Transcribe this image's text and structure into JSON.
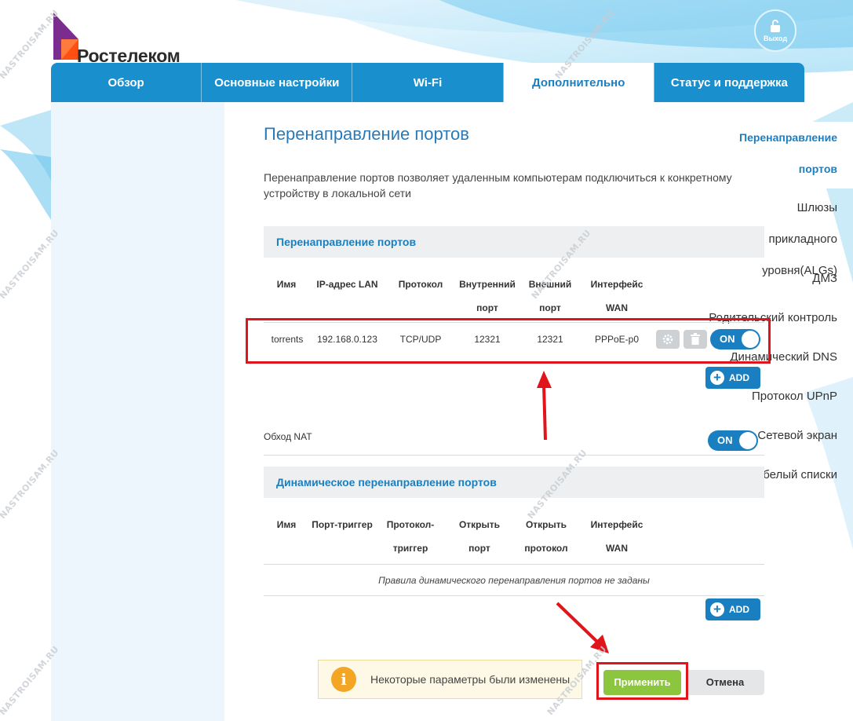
{
  "brand": {
    "name": "Ростелеком"
  },
  "header": {
    "logout_label": "Выход"
  },
  "topnav": {
    "tabs": [
      {
        "label": "Обзор",
        "active": false
      },
      {
        "label": "Основные настройки",
        "active": false
      },
      {
        "label": "Wi-Fi",
        "active": false
      },
      {
        "label": "Дополнительно",
        "active": true
      },
      {
        "label": "Статус и поддержка",
        "active": false
      }
    ]
  },
  "sidebar": {
    "items": [
      {
        "label": "Перенаправление портов",
        "active": true
      },
      {
        "label": "Шлюзы прикладного уровня(ALGs)",
        "active": false
      },
      {
        "label": "ДМЗ",
        "active": false
      },
      {
        "label": "Родительский контроль",
        "active": false
      },
      {
        "label": "Динамический DNS",
        "active": false
      },
      {
        "label": "Протокол UPnP",
        "active": false
      },
      {
        "label": "Сетевой экран",
        "active": false
      },
      {
        "label": "Черный и белый списки",
        "active": false
      }
    ]
  },
  "main": {
    "title": "Перенаправление портов",
    "description": "Перенаправление портов позволяет удаленным компьютерам подключиться к конкретному устройству в локальной сети",
    "port_forwarding": {
      "heading": "Перенаправление портов",
      "columns": [
        "Имя",
        "IP-адрес LAN",
        "Протокол",
        "Внутренний порт",
        "Внешний порт",
        "Интерфейс WAN"
      ],
      "rows": [
        {
          "name": "torrents",
          "ip": "192.168.0.123",
          "protocol": "TCP/UDP",
          "internal_port": "12321",
          "external_port": "12321",
          "interface": "PPPoE-p0",
          "toggle": "ON"
        }
      ],
      "add_label": "ADD"
    },
    "nat_bypass": {
      "label": "Обход NAT",
      "toggle": "ON"
    },
    "dynamic_forwarding": {
      "heading": "Динамическое перенаправление портов",
      "columns": [
        "Имя",
        "Порт-триггер",
        "Протокол-триггер",
        "Открыть порт",
        "Открыть протокол",
        "Интерфейс WAN"
      ],
      "empty_message": "Правила динамического перенаправления портов не заданы",
      "add_label": "ADD"
    },
    "notice": "Некоторые параметры были изменены",
    "apply_label": "Применить",
    "cancel_label": "Отмена"
  },
  "watermark": "NASTROISAM.RU",
  "colors": {
    "primary": "#1a8fcd",
    "accent_green": "#8cc63e",
    "annotation_red": "#e0141b",
    "brand_purple": "#7b2c8f",
    "brand_orange": "#ff4f12"
  }
}
